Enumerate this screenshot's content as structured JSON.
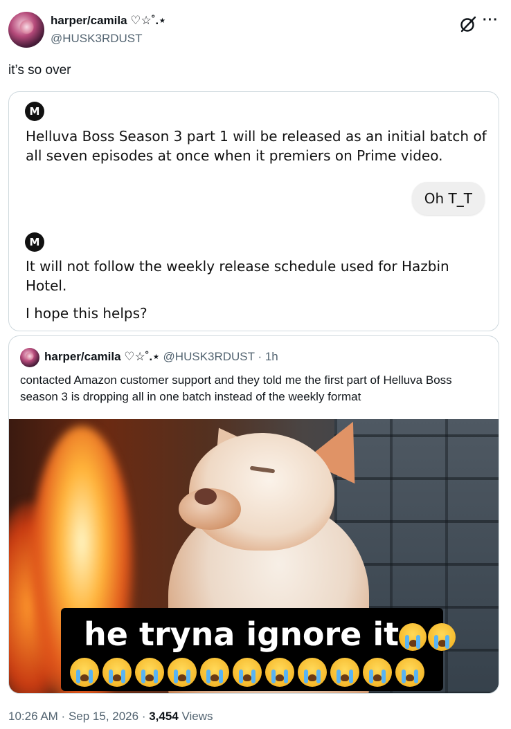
{
  "tweet": {
    "author_name": "harper/camila ♡☆˚.⋆",
    "author_handle": "@HUSK3RDUST",
    "text": "it’s so over"
  },
  "chat_screenshot": {
    "bot_badge": "M",
    "bot_message_1": "Helluva Boss Season 3 part 1 will be released as an initial batch of all seven episodes at once when it premiers on Prime video.",
    "user_message": "Oh T_T",
    "bot_message_2": "It will not follow the weekly release schedule used for Hazbin Hotel.",
    "bot_message_3": "I hope this helps?"
  },
  "quoted_tweet": {
    "author_name": "harper/camila ♡☆˚.⋆",
    "author_handle": "@HUSK3RDUST",
    "separator": " · ",
    "time_ago": "1h",
    "text": "contacted Amazon customer support and they told me the first part of Helluva Boss season 3 is dropping all in one batch instead of the weekly format",
    "meme_caption": "he tryna ignore it",
    "emoji_name": "loudly-crying-face"
  },
  "footer": {
    "time": "10:26 AM",
    "dot": " · ",
    "date": "Sep 15, 2026",
    "views_count": "3,454",
    "views_label": " Views"
  },
  "icons": {
    "grok": "grok-icon",
    "more": "more-icon"
  }
}
